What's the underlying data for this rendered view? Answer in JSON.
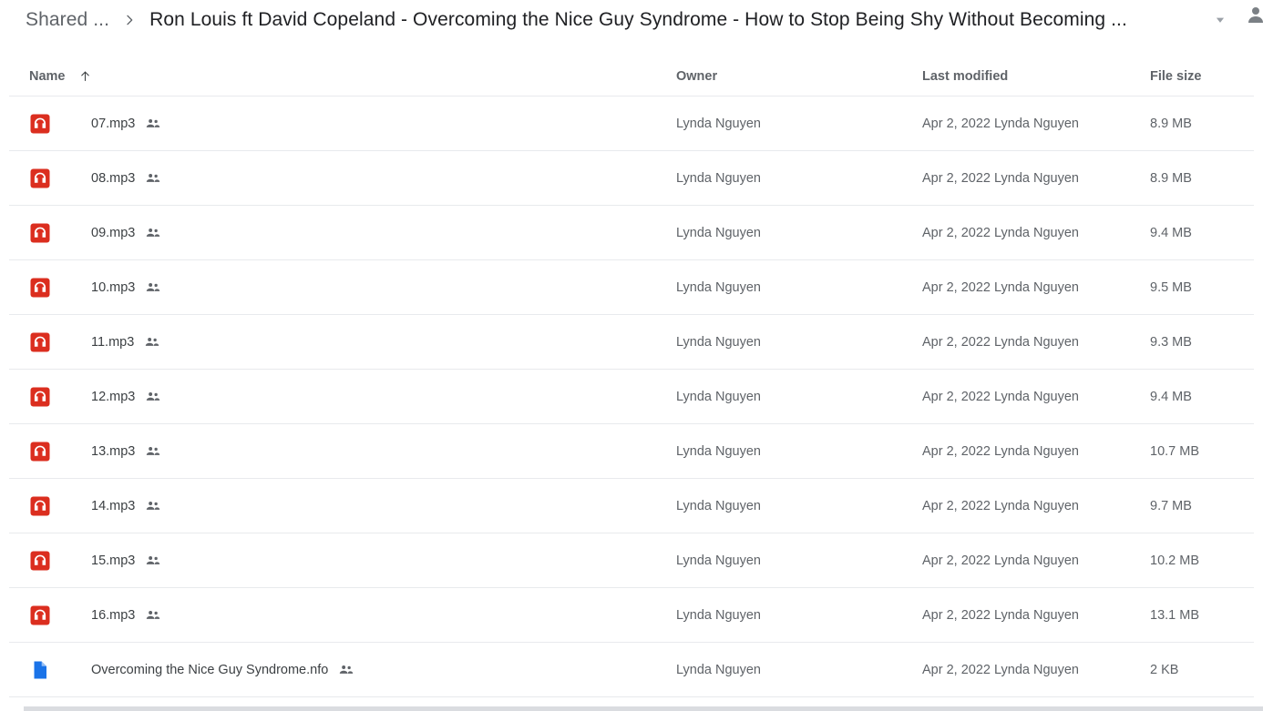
{
  "breadcrumb": {
    "parent": "Shared ...",
    "separator_icon": "chevron-right-icon",
    "current": "Ron Louis ft David Copeland - Overcoming the Nice Guy Syndrome - How to Stop Being Shy Without Becoming ...",
    "caret_icon": "chevron-down-icon",
    "avatar_icon": "person-icon"
  },
  "columns": {
    "name": "Name",
    "sort_icon": "arrow-up-icon",
    "owner": "Owner",
    "last_modified": "Last modified",
    "file_size": "File size"
  },
  "colors": {
    "audio_icon": "#DB2E1F",
    "doc_icon": "#1a73e8",
    "text_primary": "#3c4043",
    "text_secondary": "#5f6368",
    "divider": "#e8eaed"
  },
  "rows": [
    {
      "icon": "audio-file-icon",
      "name": "07.mp3",
      "shared_icon": "shared-people-icon",
      "owner": "Lynda Nguyen",
      "modified": "Apr 2, 2022 Lynda Nguyen",
      "size": "8.9 MB"
    },
    {
      "icon": "audio-file-icon",
      "name": "08.mp3",
      "shared_icon": "shared-people-icon",
      "owner": "Lynda Nguyen",
      "modified": "Apr 2, 2022 Lynda Nguyen",
      "size": "8.9 MB"
    },
    {
      "icon": "audio-file-icon",
      "name": "09.mp3",
      "shared_icon": "shared-people-icon",
      "owner": "Lynda Nguyen",
      "modified": "Apr 2, 2022 Lynda Nguyen",
      "size": "9.4 MB"
    },
    {
      "icon": "audio-file-icon",
      "name": "10.mp3",
      "shared_icon": "shared-people-icon",
      "owner": "Lynda Nguyen",
      "modified": "Apr 2, 2022 Lynda Nguyen",
      "size": "9.5 MB"
    },
    {
      "icon": "audio-file-icon",
      "name": "11.mp3",
      "shared_icon": "shared-people-icon",
      "owner": "Lynda Nguyen",
      "modified": "Apr 2, 2022 Lynda Nguyen",
      "size": "9.3 MB"
    },
    {
      "icon": "audio-file-icon",
      "name": "12.mp3",
      "shared_icon": "shared-people-icon",
      "owner": "Lynda Nguyen",
      "modified": "Apr 2, 2022 Lynda Nguyen",
      "size": "9.4 MB"
    },
    {
      "icon": "audio-file-icon",
      "name": "13.mp3",
      "shared_icon": "shared-people-icon",
      "owner": "Lynda Nguyen",
      "modified": "Apr 2, 2022 Lynda Nguyen",
      "size": "10.7 MB"
    },
    {
      "icon": "audio-file-icon",
      "name": "14.mp3",
      "shared_icon": "shared-people-icon",
      "owner": "Lynda Nguyen",
      "modified": "Apr 2, 2022 Lynda Nguyen",
      "size": "9.7 MB"
    },
    {
      "icon": "audio-file-icon",
      "name": "15.mp3",
      "shared_icon": "shared-people-icon",
      "owner": "Lynda Nguyen",
      "modified": "Apr 2, 2022 Lynda Nguyen",
      "size": "10.2 MB"
    },
    {
      "icon": "audio-file-icon",
      "name": "16.mp3",
      "shared_icon": "shared-people-icon",
      "owner": "Lynda Nguyen",
      "modified": "Apr 2, 2022 Lynda Nguyen",
      "size": "13.1 MB"
    },
    {
      "icon": "document-file-icon",
      "name": "Overcoming the Nice Guy Syndrome.nfo",
      "shared_icon": "shared-people-icon",
      "owner": "Lynda Nguyen",
      "modified": "Apr 2, 2022 Lynda Nguyen",
      "size": "2 KB"
    }
  ]
}
